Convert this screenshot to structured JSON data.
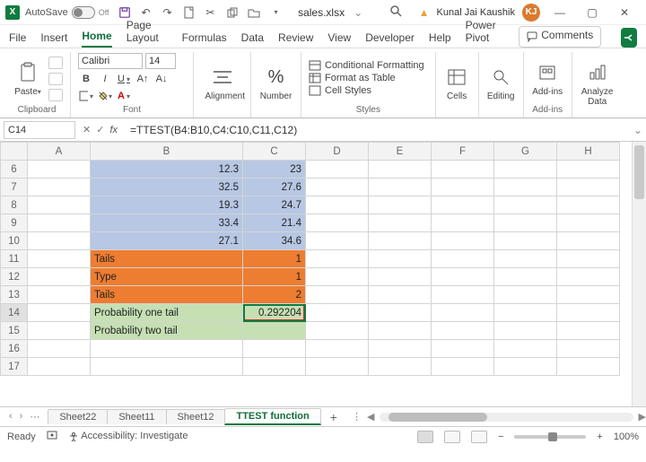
{
  "titlebar": {
    "autosave_label": "AutoSave",
    "autosave_state": "Off",
    "filename": "sales.xlsx",
    "filemenu_caret": "⌄",
    "user_name": "Kunal Jai Kaushik",
    "user_initials": "KJ"
  },
  "menu": {
    "items": [
      "File",
      "Insert",
      "Home",
      "Page Layout",
      "Formulas",
      "Data",
      "Review",
      "View",
      "Developer",
      "Help",
      "Power Pivot"
    ],
    "active": "Home",
    "comments_label": "Comments"
  },
  "ribbon": {
    "clipboard": {
      "paste": "Paste",
      "label": "Clipboard"
    },
    "font": {
      "name": "Calibri",
      "size": "14",
      "label": "Font"
    },
    "alignment": {
      "btn": "Alignment"
    },
    "number": {
      "btn": "Number",
      "symbol": "%"
    },
    "styles": {
      "cond": "Conditional Formatting",
      "table": "Format as Table",
      "cell": "Cell Styles",
      "label": "Styles"
    },
    "cells": {
      "btn": "Cells"
    },
    "editing": {
      "btn": "Editing"
    },
    "addins": {
      "btn": "Add-ins",
      "label": "Add-ins"
    },
    "analyze": {
      "btn": "Analyze Data"
    }
  },
  "formula_bar": {
    "cellref": "C14",
    "formula": "=TTEST(B4:B10,C4:C10,C11,C12)"
  },
  "columns": [
    "A",
    "B",
    "C",
    "D",
    "E",
    "F",
    "G",
    "H"
  ],
  "rows": [
    {
      "r": "6",
      "b": "12.3",
      "c": "23",
      "cls": "blue",
      "bnum": true
    },
    {
      "r": "7",
      "b": "32.5",
      "c": "27.6",
      "cls": "blue",
      "bnum": true
    },
    {
      "r": "8",
      "b": "19.3",
      "c": "24.7",
      "cls": "blue",
      "bnum": true
    },
    {
      "r": "9",
      "b": "33.4",
      "c": "21.4",
      "cls": "blue",
      "bnum": true
    },
    {
      "r": "10",
      "b": "27.1",
      "c": "34.6",
      "cls": "blue",
      "bnum": true
    },
    {
      "r": "11",
      "b": "Tails",
      "c": "1",
      "cls": "orange",
      "bnum": false
    },
    {
      "r": "12",
      "b": "Type",
      "c": "1",
      "cls": "orange",
      "bnum": false
    },
    {
      "r": "13",
      "b": "Tails",
      "c": "2",
      "cls": "orange",
      "bnum": false
    },
    {
      "r": "14",
      "b": "Probability one tail",
      "c": "0.292204",
      "cls": "green",
      "bnum": false,
      "active": true
    },
    {
      "r": "15",
      "b": "Probability two tail",
      "c": "",
      "cls": "green",
      "bnum": false
    },
    {
      "r": "16",
      "b": "",
      "c": "",
      "cls": "",
      "bnum": false
    },
    {
      "r": "17",
      "b": "",
      "c": "",
      "cls": "",
      "bnum": false
    }
  ],
  "tabs": {
    "sheets": [
      "Sheet22",
      "Sheet11",
      "Sheet12",
      "TTEST function"
    ],
    "active": "TTEST function"
  },
  "status": {
    "mode": "Ready",
    "accessibility": "Accessibility: Investigate",
    "zoom": "100%"
  }
}
